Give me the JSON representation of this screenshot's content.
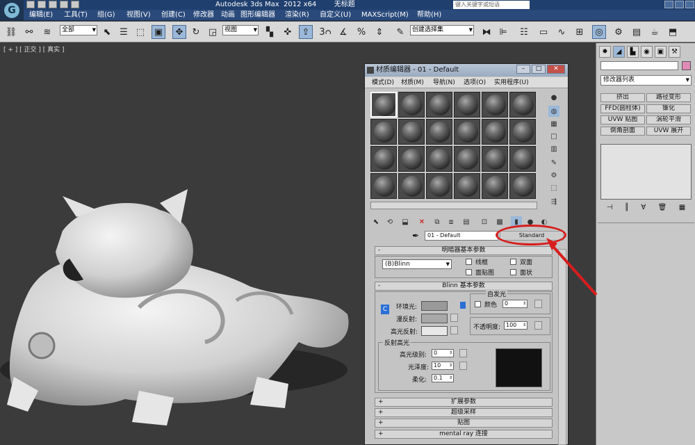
{
  "window": {
    "title_text": "Autodesk 3ds Max  2012 x64        无标题",
    "search_placeholder": "键入关键字或短语"
  },
  "menubar": [
    "编辑(E)",
    "工具(T)",
    "组(G)",
    "视图(V)",
    "创建(C)",
    "修改器",
    "动画",
    "图形编辑器",
    "渲染(R)",
    "自定义(U)",
    "MAXScript(M)",
    "帮助(H)"
  ],
  "toolbar": {
    "selection_filter": "全部",
    "ref_coord": "视图",
    "named_sel": "创建选择集",
    "snap_label": "3"
  },
  "viewport": {
    "label": "[ + ] [ 正交 ] [ 真实 ]"
  },
  "command_panel": {
    "modifier_list": "修改器列表",
    "modifiers": [
      "挤出",
      "路径变形",
      "FFD(圆柱体)",
      "锥化",
      "UVW 贴图",
      "涡轮平滑",
      "倒角剖面",
      "UVW 展开"
    ],
    "object_color": "#e08ab6"
  },
  "material_editor": {
    "title": "材质编辑器 - 01 - Default",
    "menu": [
      "模式(D)",
      "材质(M)",
      "导航(N)",
      "选项(O)",
      "实用程序(U)"
    ],
    "material_name": "01 - Default",
    "material_type": "Standard",
    "shader_rollout": {
      "title": "明暗器基本参数",
      "shader": "(B)Blinn",
      "wire": "线框",
      "two_sided": "双面",
      "face_map": "面贴图",
      "faceted": "面状"
    },
    "blinn_rollout": {
      "title": "Blinn 基本参数",
      "self_illum": "自发光",
      "color_label": "颜色",
      "color_value": "0",
      "ambient": "环境光:",
      "diffuse": "漫反射:",
      "specular": "高光反射:",
      "opacity_label": "不透明度:",
      "opacity_value": "100",
      "lock_label": "C"
    },
    "spec_highlights": {
      "title": "反射高光",
      "level_label": "高光级别:",
      "level_value": "0",
      "gloss_label": "光泽度:",
      "gloss_value": "10",
      "soften_label": "柔化:",
      "soften_value": "0.1"
    },
    "extra_rollouts": [
      "扩展参数",
      "超级采样",
      "贴图",
      "mental ray 连接"
    ],
    "annotation_color": "#d81d1d"
  }
}
